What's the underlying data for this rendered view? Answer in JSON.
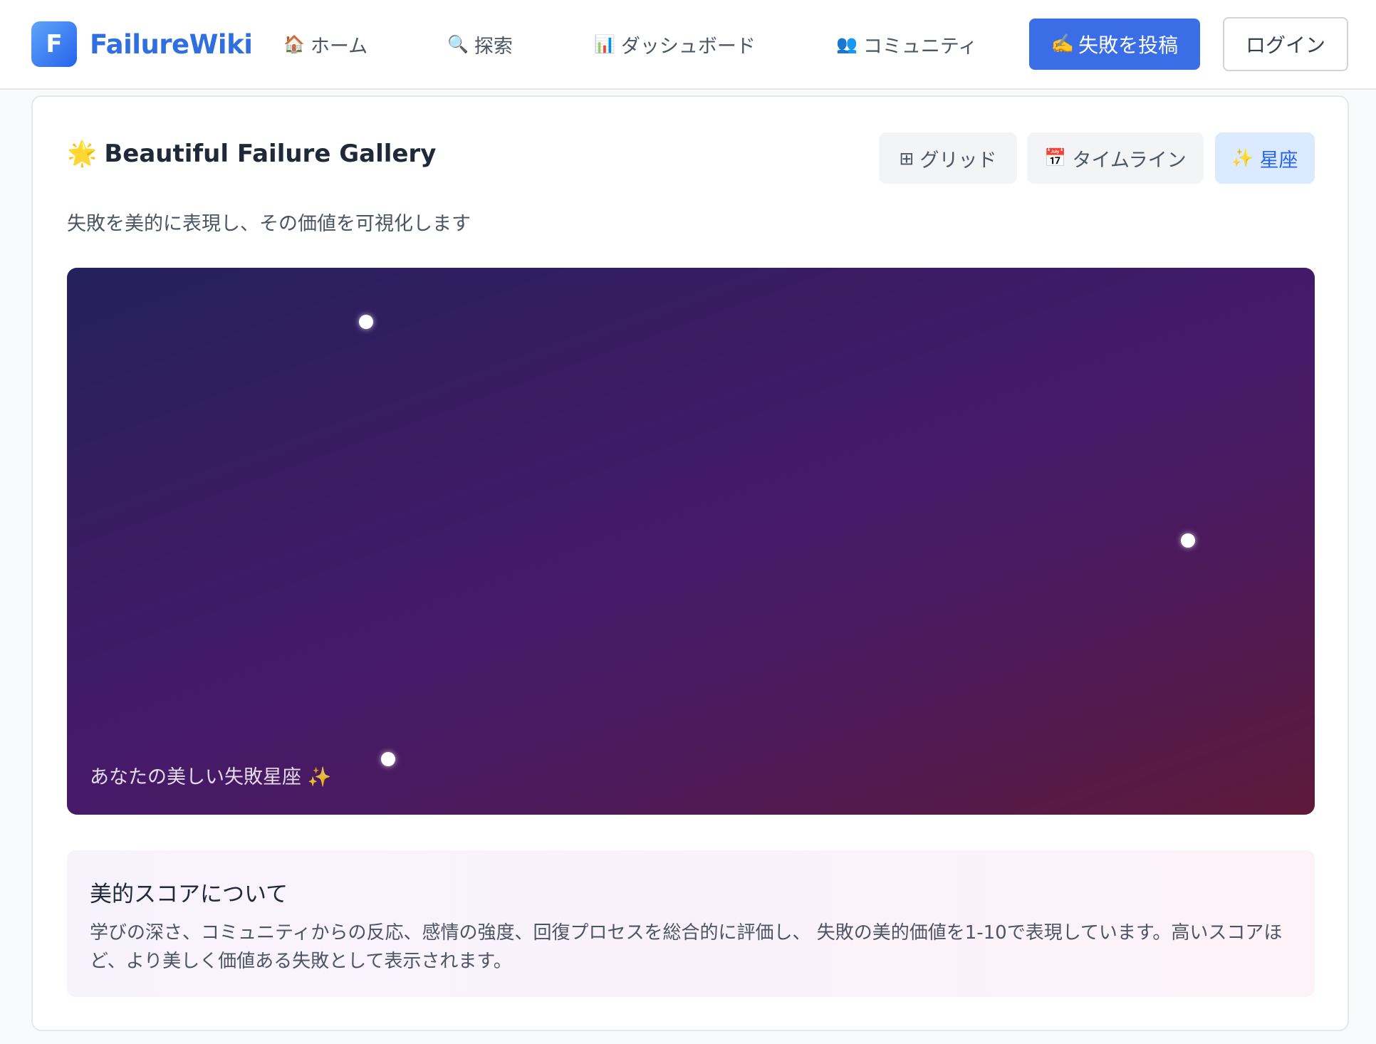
{
  "header": {
    "logo_letter": "F",
    "logo_text": "FailureWiki",
    "nav": [
      {
        "icon": "🏠",
        "label": "ホーム"
      },
      {
        "icon": "🔍",
        "label": "探索"
      },
      {
        "icon": "📊",
        "label": "ダッシュボード"
      },
      {
        "icon": "👥",
        "label": "コミュニティ"
      }
    ],
    "post_button": {
      "icon": "✍️",
      "label": "失敗を投稿"
    },
    "login_button": "ログイン"
  },
  "gallery": {
    "title_icon": "🌟",
    "title": "Beautiful Failure Gallery",
    "subtitle": "失敗を美的に表現し、その価値を可視化します",
    "views": [
      {
        "icon": "⊞",
        "label": "グリッド",
        "active": false
      },
      {
        "icon": "📅",
        "label": "タイムライン",
        "active": false
      },
      {
        "icon": "✨",
        "label": "星座",
        "active": true
      }
    ],
    "constellation_caption": "あなたの美しい失敗星座 ✨"
  },
  "info": {
    "title": "美的スコアについて",
    "body": "学びの深さ、コミュニティからの反応、感情の強度、回復プロセスを総合的に評価し、 失敗の美的価値を1-10で表現しています。高いスコアほど、より美しく価値ある失敗として表示されます。"
  },
  "colors": {
    "brand": "#2f6fe0",
    "primary_button": "#3b6ee6",
    "active_view_bg": "#dbeafe",
    "constellation_start": "#24215c",
    "constellation_end": "#5e1a3a"
  }
}
